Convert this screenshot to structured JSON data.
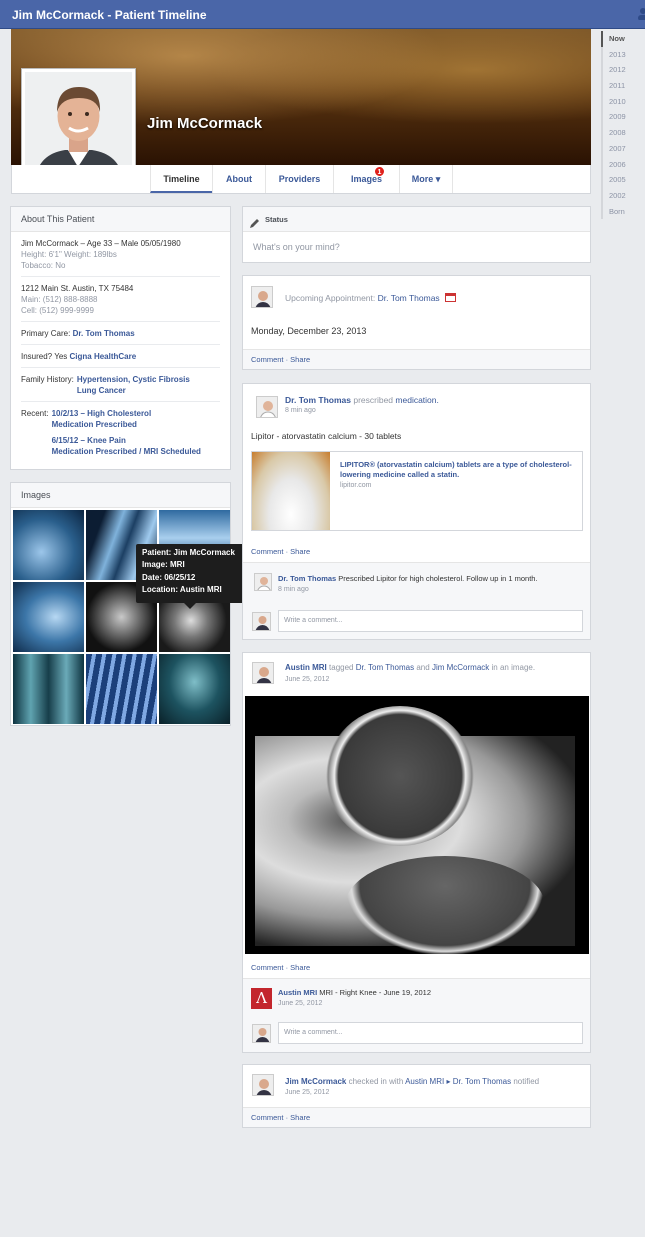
{
  "window_title": "Jim McCormack - Patient Timeline",
  "profile": {
    "name": "Jim McCormack"
  },
  "nav": {
    "timeline": "Timeline",
    "about": "About",
    "providers": "Providers",
    "images": "Images",
    "images_badge": "1",
    "more": "More ▾"
  },
  "years": [
    "Now",
    "2013",
    "2012",
    "2011",
    "2010",
    "2009",
    "2008",
    "2007",
    "2006",
    "2005",
    "2002",
    "Born"
  ],
  "about": {
    "header": "About This Patient",
    "line1": "Jim McCormack – Age 33 – Male  05/05/1980",
    "line2": "Height: 6'1\"  Weight: 189lbs",
    "line3": "Tobacco: No",
    "addr1": "1212 Main St.  Austin, TX 75484",
    "addr2": "Main: (512) 888-8888",
    "addr3": "Cell: (512) 999-9999",
    "primary_label": "Primary Care:",
    "primary_value": "Dr. Tom Thomas",
    "insured_label": "Insured? Yes",
    "insured_value": "Cigna HealthCare",
    "family_label": "Family History:",
    "family_value1": "Hypertension, Cystic Fibrosis",
    "family_value2": "Lung Cancer",
    "recent_label": "Recent:",
    "recent1a": "10/2/13 – High Cholesterol",
    "recent1b": "Medication Prescribed",
    "recent2a": "6/15/12 – Knee Pain",
    "recent2b": "Medication Prescribed / MRI Scheduled"
  },
  "images": {
    "header": "Images"
  },
  "tooltip": {
    "l1": "Patient: Jim McCormack",
    "l2": "Image: MRI",
    "l3": "Date: 06/25/12",
    "l4": "Location: Austin MRI"
  },
  "status": {
    "label": "Status",
    "placeholder": "What's on your mind?"
  },
  "post1": {
    "prefix": "Upcoming Appointment:",
    "doctor": "Dr. Tom Thomas",
    "date": "Monday, December 23, 2013"
  },
  "actions": "Comment · Share",
  "post2": {
    "author": "Dr. Tom Thomas",
    "verb": "prescribed",
    "object": "medication.",
    "time": "8 min ago",
    "text": "Lipitor - atorvastatin calcium - 30 tablets",
    "link_title": "LIPITOR® (atorvastatin calcium) tablets are a type of cholesterol-lowering medicine called a statin.",
    "link_domain": "lipitor.com",
    "comment_author": "Dr. Tom Thomas",
    "comment_text": "Prescribed Lipitor for high cholesterol.  Follow up in 1 month.",
    "comment_time": "8 min ago"
  },
  "write_comment": "Write a comment...",
  "post3": {
    "author": "Austin MRI",
    "verb": "tagged",
    "p1": "Dr. Tom Thomas",
    "and": "and",
    "p2": "Jim McCormack",
    "suffix": "in an image.",
    "time": "June 25, 2012",
    "comment_author": "Austin MRI",
    "comment_text": "MRI - Right Knee - June 19, 2012",
    "comment_time": "June 25, 2012"
  },
  "post4": {
    "author": "Jim McCormack",
    "verb": "checked in with",
    "p1": "Austin MRI",
    "arrow": "▸",
    "p2": "Dr. Tom Thomas",
    "suffix": "notified",
    "time": "June 25, 2012"
  }
}
